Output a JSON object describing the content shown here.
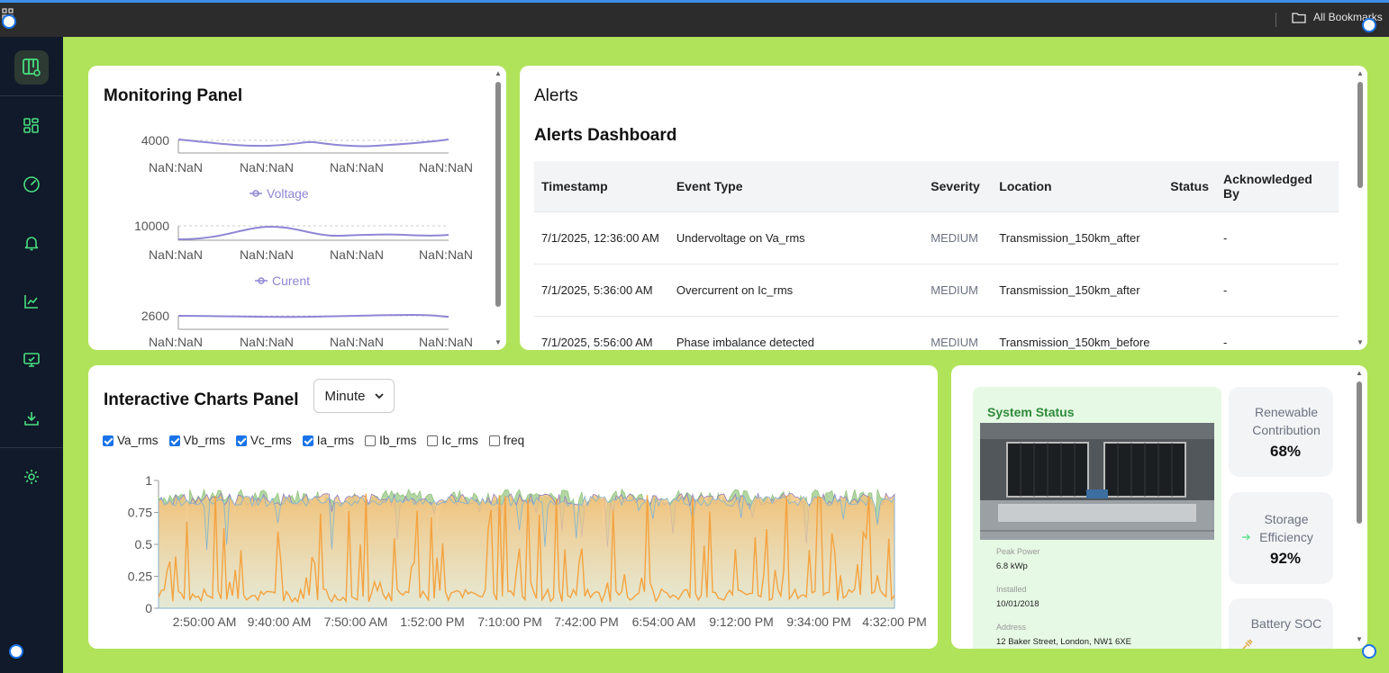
{
  "browser": {
    "bookmarks_label": "All Bookmarks"
  },
  "monitoring": {
    "title": "Monitoring Panel",
    "x_ticks": [
      "NaN:NaN",
      "NaN:NaN",
      "NaN:NaN",
      "NaN:NaN"
    ],
    "charts": [
      {
        "y_tick": "4000",
        "legend": "Voltage"
      },
      {
        "y_tick": "10000",
        "legend": "Curent"
      },
      {
        "y_tick": "2600",
        "legend": ""
      }
    ]
  },
  "alerts": {
    "title": "Alerts",
    "dashboard_title": "Alerts Dashboard",
    "columns": [
      "Timestamp",
      "Event Type",
      "Severity",
      "Location",
      "Status",
      "Acknowledged By"
    ],
    "rows": [
      {
        "timestamp": "7/1/2025, 12:36:00 AM",
        "event": "Undervoltage on Va_rms",
        "severity": "MEDIUM",
        "location": "Transmission_150km_after",
        "status": "",
        "ack": "-"
      },
      {
        "timestamp": "7/1/2025, 5:36:00 AM",
        "event": "Overcurrent on Ic_rms",
        "severity": "MEDIUM",
        "location": "Transmission_150km_after",
        "status": "",
        "ack": "-"
      },
      {
        "timestamp": "7/1/2025, 5:56:00 AM",
        "event": "Phase imbalance detected",
        "severity": "MEDIUM",
        "location": "Transmission_150km_before",
        "status": "",
        "ack": "-"
      }
    ]
  },
  "interactive": {
    "title": "Interactive Charts Panel",
    "granularity": "Minute",
    "filters": [
      {
        "label": "Va_rms",
        "checked": true
      },
      {
        "label": "Vb_rms",
        "checked": true
      },
      {
        "label": "Vc_rms",
        "checked": true
      },
      {
        "label": "Ia_rms",
        "checked": true
      },
      {
        "label": "Ib_rms",
        "checked": false
      },
      {
        "label": "Ic_rms",
        "checked": false
      },
      {
        "label": "freq",
        "checked": false
      }
    ],
    "y_ticks": [
      "1",
      "0.75",
      "0.5",
      "0.25",
      "0"
    ],
    "x_ticks": [
      "2:50:00 AM",
      "9:40:00 AM",
      "7:50:00 AM",
      "1:52:00 PM",
      "7:10:00 PM",
      "7:42:00 PM",
      "6:54:00 AM",
      "9:12:00 PM",
      "9:34:00 PM",
      "4:32:00 PM"
    ]
  },
  "chart_data": {
    "type": "area",
    "x": [
      "2:50:00 AM",
      "9:40:00 AM",
      "7:50:00 AM",
      "1:52:00 PM",
      "7:10:00 PM",
      "7:42:00 PM",
      "6:54:00 AM",
      "9:12:00 PM",
      "9:34:00 PM",
      "4:32:00 PM"
    ],
    "ylim": [
      0,
      1
    ],
    "series": [
      {
        "name": "Va_rms",
        "color": "#7fb3d5"
      },
      {
        "name": "Vb_rms",
        "color": "#8e7cc3"
      },
      {
        "name": "Vc_rms",
        "color": "#93c47d"
      },
      {
        "name": "Ia_rms",
        "color": "#f4a340"
      }
    ]
  },
  "system_status": {
    "title": "System Status",
    "peak_power_label": "Peak Power",
    "peak_power": "6.8 kWp",
    "installed_label": "Installed",
    "installed": "10/01/2018",
    "address_label": "Address",
    "address": "12 Baker Street, London, NW1 6XE"
  },
  "kpis": [
    {
      "label": "Renewable Contribution",
      "value": "68%"
    },
    {
      "label": "Storage Efficiency",
      "value": "92%"
    },
    {
      "label": "Battery SOC",
      "value": ""
    }
  ],
  "colors": {
    "accent": "#b1e35a",
    "sidebar": "#101a2a",
    "icon": "#4ade80",
    "line": "#8f86d6"
  }
}
